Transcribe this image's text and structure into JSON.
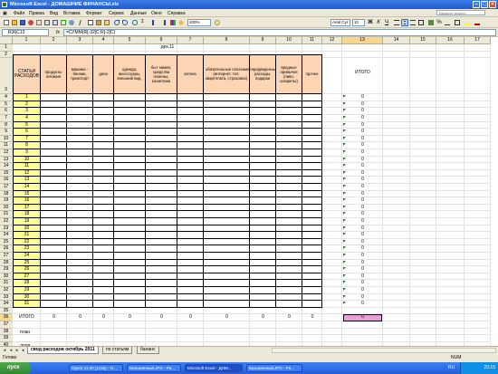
{
  "window": {
    "title": "Microsoft Excel - ДОМАШНИЕ ФИНАНСЫ.xls"
  },
  "menu": {
    "items": [
      "Файл",
      "Правка",
      "Вид",
      "Вставка",
      "Формат",
      "Сервис",
      "Данные",
      "Окно",
      "Справка"
    ],
    "help_placeholder": "Введите вопрос"
  },
  "toolbar": {
    "font": "Arial Cyr",
    "size": "10"
  },
  "formula": {
    "name_box": "R36C13",
    "fx": "fx",
    "value": "=СУММ(R[-32]C:R[-2]C)"
  },
  "columns": [
    "1",
    "2",
    "3",
    "4",
    "5",
    "6",
    "7",
    "8",
    "9",
    "10",
    "11",
    "12",
    "13",
    "14",
    "15",
    "16",
    "17"
  ],
  "rows": [
    "1",
    "2",
    "3",
    "4",
    "5",
    "6",
    "7",
    "8",
    "9",
    "10",
    "11",
    "12",
    "13",
    "14",
    "15",
    "16",
    "17",
    "18",
    "19",
    "20",
    "21",
    "22",
    "23",
    "24",
    "25",
    "26",
    "27",
    "28",
    "29",
    "30",
    "31",
    "32",
    "33",
    "34",
    "35",
    "36",
    "37",
    "38",
    "39",
    "40",
    "41"
  ],
  "sheet": {
    "month": "дек.11",
    "headers": [
      "СТАТЬИ РАСХОДОВ",
      "продукты питания",
      "машина - бензин, транспорт",
      "дача",
      "одежда, аксессуары, внешний вид.",
      "быт химия, средства гигиены, косметика",
      "аптека",
      "обязательные платежи (интернет, тел. квартплата, страховка)",
      "непредвиденные расходы, подарки",
      "вредные привычки (пиво, сигареты)",
      "прочее"
    ],
    "itogo_header": "ИТОГО",
    "days": [
      "1",
      "2",
      "3",
      "4",
      "5",
      "6",
      "7",
      "8",
      "9",
      "10",
      "11",
      "12",
      "13",
      "14",
      "15",
      "16",
      "17",
      "18",
      "19",
      "20",
      "21",
      "22",
      "23",
      "24",
      "25",
      "26",
      "27",
      "28",
      "29",
      "30",
      "31"
    ],
    "row_totals": [
      "0",
      "0",
      "0",
      "0",
      "0",
      "0",
      "0",
      "0",
      "0",
      "0",
      "0",
      "0",
      "0",
      "0",
      "0",
      "0",
      "0",
      "0",
      "0",
      "0",
      "0",
      "0",
      "0",
      "0",
      "0",
      "0",
      "0",
      "0",
      "0",
      "0",
      "0"
    ],
    "total_label": "ИТОГО",
    "total_values": [
      "0",
      "0",
      "0",
      "0",
      "0",
      "0",
      "0",
      "0",
      "0",
      "0"
    ],
    "grand_total": "0",
    "plan_label": "план",
    "share_label": "доля",
    "percent_label": "%"
  },
  "tabs": {
    "active": "свод расходов октябрь 2011",
    "others": [
      "по статьям",
      "баланс"
    ]
  },
  "status": {
    "left": "Готово",
    "right": "NUM"
  },
  "taskbar": {
    "start": "пуск",
    "tasks": [
      "Opera 11.00 (1156) - O...",
      "Безымянный.JPG - Pa...",
      "Microsoft Excel - ДОМ...",
      "Безымянный.JPG - Pa..."
    ],
    "lang": "RU",
    "clock": "20:15"
  },
  "colors": {
    "header_fill": "#fcd5b4",
    "day_fill": "#ffff99",
    "grand_total_fill": "#e6a0d6",
    "title_bar": "#245edb"
  }
}
